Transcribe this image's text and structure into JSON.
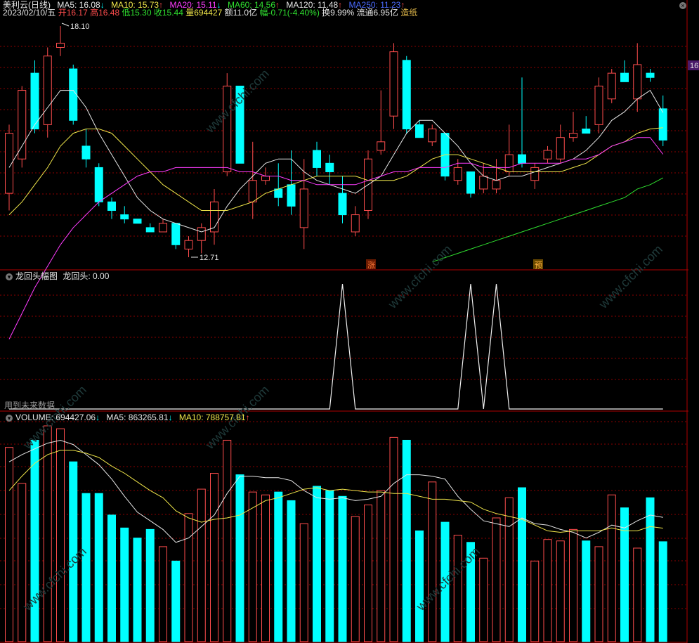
{
  "header": {
    "stock_name": "美利云(日线)",
    "ma5": "MA5: 16.08",
    "ma5_arrow": "↓",
    "ma10": "MA10: 15.73",
    "ma10_arrow": "↑",
    "ma20": "MA20: 15.11",
    "ma20_arrow": "↓",
    "ma60": "MA60: 14.56",
    "ma60_arrow": "↑",
    "ma120": "MA120: 11.48",
    "ma120_arrow": "↑",
    "ma250": "MA250: 11.23",
    "ma250_arrow": "↑",
    "date": "2023/02/10/五",
    "open": "开16.17",
    "high": "高16.48",
    "low": "低15.30",
    "close": "收15.44",
    "volume": "量694427",
    "amount": "额11.0亿",
    "change": "幅-0.71(-4.40%)",
    "turnover": "换9.99%",
    "float_cap": "流通6.95亿",
    "concept": "造纸",
    "price_tag": "16"
  },
  "indicator": {
    "title": "龙回头幅图",
    "value_label": "龙回头: 0.00",
    "note": "用到未来数据"
  },
  "volume_panel": {
    "vol_label": "VOLUME: 694427.06",
    "vol_arrow": "↓",
    "ma5_label": "MA5: 863265.81",
    "ma5_arrow": "↓",
    "ma10_label": "MA10: 788757.81",
    "ma10_arrow": "↑"
  },
  "annotations": {
    "high_label": "18.10",
    "low_label": "12.71",
    "zhang_mark": "涨",
    "yu_mark": "预"
  },
  "watermark": "www.cfchi.com",
  "colors": {
    "up": "#ff4d4d",
    "down": "#00ffff",
    "ma5": "#e6e6e6",
    "ma10": "#f0e64a",
    "ma20": "#ff3cff",
    "ma60": "#2fe02f",
    "grid": "#8b0000"
  },
  "chart_data": {
    "type": "candlestick",
    "candles": [
      {
        "o": 14.2,
        "h": 15.8,
        "l": 13.8,
        "c": 15.6
      },
      {
        "o": 15.0,
        "h": 16.7,
        "l": 14.8,
        "c": 16.6
      },
      {
        "o": 17.0,
        "h": 17.3,
        "l": 15.6,
        "c": 15.7
      },
      {
        "o": 15.8,
        "h": 17.6,
        "l": 15.5,
        "c": 17.4
      },
      {
        "o": 17.6,
        "h": 18.1,
        "l": 17.4,
        "c": 17.7
      },
      {
        "o": 17.1,
        "h": 17.2,
        "l": 15.8,
        "c": 15.9
      },
      {
        "o": 15.3,
        "h": 15.7,
        "l": 14.8,
        "c": 15.0
      },
      {
        "o": 14.8,
        "h": 14.9,
        "l": 13.9,
        "c": 14.0
      },
      {
        "o": 14.0,
        "h": 14.1,
        "l": 13.6,
        "c": 13.8
      },
      {
        "o": 13.7,
        "h": 13.9,
        "l": 13.5,
        "c": 13.6
      },
      {
        "o": 13.6,
        "h": 13.6,
        "l": 13.5,
        "c": 13.5
      },
      {
        "o": 13.4,
        "h": 13.5,
        "l": 13.3,
        "c": 13.3
      },
      {
        "o": 13.3,
        "h": 13.6,
        "l": 13.3,
        "c": 13.5
      },
      {
        "o": 13.5,
        "h": 13.5,
        "l": 12.9,
        "c": 13.0
      },
      {
        "o": 12.9,
        "h": 13.2,
        "l": 12.71,
        "c": 13.1
      },
      {
        "o": 13.1,
        "h": 13.5,
        "l": 12.8,
        "c": 13.4
      },
      {
        "o": 13.3,
        "h": 14.3,
        "l": 13.0,
        "c": 14.0
      },
      {
        "o": 14.7,
        "h": 17.0,
        "l": 14.6,
        "c": 16.7
      },
      {
        "o": 16.7,
        "h": 16.7,
        "l": 14.9,
        "c": 14.9
      },
      {
        "o": 14.0,
        "h": 15.4,
        "l": 13.6,
        "c": 14.5
      },
      {
        "o": 14.5,
        "h": 14.8,
        "l": 14.4,
        "c": 14.6
      },
      {
        "o": 14.3,
        "h": 14.9,
        "l": 13.9,
        "c": 14.1
      },
      {
        "o": 14.4,
        "h": 15.2,
        "l": 13.7,
        "c": 13.9
      },
      {
        "o": 13.4,
        "h": 15.0,
        "l": 12.9,
        "c": 14.3
      },
      {
        "o": 15.2,
        "h": 15.4,
        "l": 14.6,
        "c": 14.8
      },
      {
        "o": 14.9,
        "h": 15.1,
        "l": 14.4,
        "c": 14.7
      },
      {
        "o": 14.2,
        "h": 14.6,
        "l": 13.5,
        "c": 13.7
      },
      {
        "o": 13.3,
        "h": 13.9,
        "l": 13.2,
        "c": 13.7
      },
      {
        "o": 13.8,
        "h": 15.2,
        "l": 13.6,
        "c": 15.0
      },
      {
        "o": 15.2,
        "h": 16.6,
        "l": 15.1,
        "c": 15.4
      },
      {
        "o": 16.0,
        "h": 17.7,
        "l": 15.7,
        "c": 17.5
      },
      {
        "o": 17.3,
        "h": 17.4,
        "l": 15.6,
        "c": 15.7
      },
      {
        "o": 15.8,
        "h": 15.9,
        "l": 15.5,
        "c": 15.5
      },
      {
        "o": 15.4,
        "h": 15.8,
        "l": 15.3,
        "c": 15.7
      },
      {
        "o": 15.6,
        "h": 15.6,
        "l": 14.5,
        "c": 14.6
      },
      {
        "o": 14.5,
        "h": 15.0,
        "l": 14.4,
        "c": 14.8
      },
      {
        "o": 14.7,
        "h": 14.7,
        "l": 14.1,
        "c": 14.2
      },
      {
        "o": 14.3,
        "h": 14.9,
        "l": 14.2,
        "c": 14.6
      },
      {
        "o": 14.3,
        "h": 15.0,
        "l": 14.2,
        "c": 14.5
      },
      {
        "o": 14.7,
        "h": 15.8,
        "l": 14.6,
        "c": 15.1
      },
      {
        "o": 15.1,
        "h": 16.9,
        "l": 14.8,
        "c": 14.9
      },
      {
        "o": 14.5,
        "h": 14.9,
        "l": 14.3,
        "c": 14.8
      },
      {
        "o": 15.0,
        "h": 15.3,
        "l": 14.9,
        "c": 15.2
      },
      {
        "o": 15.0,
        "h": 15.8,
        "l": 14.9,
        "c": 15.5
      },
      {
        "o": 15.5,
        "h": 16.1,
        "l": 15.4,
        "c": 15.6
      },
      {
        "o": 15.7,
        "h": 16.0,
        "l": 15.6,
        "c": 15.6
      },
      {
        "o": 15.8,
        "h": 16.9,
        "l": 15.6,
        "c": 16.7
      },
      {
        "o": 16.4,
        "h": 17.1,
        "l": 16.3,
        "c": 17.0
      },
      {
        "o": 17.0,
        "h": 17.3,
        "l": 16.8,
        "c": 16.8
      },
      {
        "o": 16.4,
        "h": 17.7,
        "l": 16.1,
        "c": 17.2
      },
      {
        "o": 17.0,
        "h": 17.1,
        "l": 16.8,
        "c": 16.9
      },
      {
        "o": 16.17,
        "h": 16.48,
        "l": 15.3,
        "c": 15.44
      }
    ],
    "ma5": [
      14.8,
      15.3,
      15.8,
      16.2,
      16.6,
      16.6,
      16.2,
      15.6,
      15.1,
      14.6,
      14.1,
      13.8,
      13.6,
      13.5,
      13.4,
      13.3,
      13.4,
      13.9,
      14.3,
      14.6,
      14.9,
      15.0,
      15.0,
      14.7,
      14.5,
      14.4,
      14.3,
      14.2,
      14.4,
      14.6,
      15.1,
      15.6,
      15.9,
      15.9,
      15.6,
      15.3,
      14.9,
      14.6,
      14.5,
      14.6,
      14.6,
      14.7,
      14.8,
      14.9,
      15.0,
      15.2,
      15.5,
      15.9,
      16.1,
      16.4,
      16.6,
      16.08
    ],
    "ma10": [
      13.7,
      14.0,
      14.4,
      14.8,
      15.3,
      15.6,
      15.7,
      15.7,
      15.6,
      15.3,
      15.0,
      14.7,
      14.4,
      14.2,
      14.0,
      13.8,
      13.8,
      13.8,
      13.9,
      14.0,
      14.2,
      14.3,
      14.4,
      14.5,
      14.6,
      14.6,
      14.6,
      14.6,
      14.5,
      14.5,
      14.5,
      14.6,
      14.8,
      15.0,
      15.1,
      15.1,
      15.0,
      14.9,
      14.8,
      14.7,
      14.7,
      14.7,
      14.7,
      14.7,
      14.8,
      14.9,
      15.1,
      15.3,
      15.4,
      15.6,
      15.7,
      15.73
    ],
    "ma20": [
      10.8,
      11.4,
      12.0,
      12.5,
      13.0,
      13.4,
      13.7,
      14.0,
      14.2,
      14.4,
      14.6,
      14.7,
      14.7,
      14.8,
      14.8,
      14.8,
      14.8,
      14.8,
      14.7,
      14.7,
      14.6,
      14.6,
      14.5,
      14.5,
      14.4,
      14.4,
      14.4,
      14.4,
      14.5,
      14.6,
      14.7,
      14.7,
      14.8,
      14.8,
      14.8,
      14.9,
      14.9,
      14.8,
      14.8,
      14.8,
      14.9,
      14.9,
      14.9,
      14.9,
      15.0,
      15.0,
      15.1,
      15.3,
      15.4,
      15.5,
      15.5,
      15.11
    ],
    "ma60": [
      null,
      null,
      null,
      null,
      null,
      null,
      null,
      null,
      null,
      null,
      null,
      null,
      null,
      null,
      null,
      null,
      null,
      null,
      null,
      null,
      null,
      null,
      null,
      null,
      null,
      null,
      null,
      null,
      null,
      null,
      null,
      null,
      null,
      12.6,
      12.7,
      12.8,
      12.9,
      13.0,
      13.1,
      13.2,
      13.3,
      13.4,
      13.5,
      13.6,
      13.7,
      13.8,
      13.9,
      14.0,
      14.1,
      14.3,
      14.4,
      14.56
    ],
    "dragon": [
      0,
      0,
      0,
      0,
      0,
      0,
      0,
      0,
      0,
      0,
      0,
      0,
      0,
      0,
      0,
      0,
      0,
      0,
      0,
      0,
      0,
      0,
      0,
      0,
      0,
      0,
      1,
      0,
      0,
      0,
      0,
      0,
      0,
      0,
      0,
      0,
      1,
      0,
      1,
      0,
      0,
      0,
      0,
      0,
      0,
      0,
      0,
      0,
      0,
      0,
      0,
      0
    ],
    "volume": [
      1350000,
      1100000,
      1400000,
      1500000,
      1480000,
      1250000,
      1030000,
      1030000,
      880000,
      790000,
      720000,
      780000,
      660000,
      560000,
      890000,
      1060000,
      1170000,
      1400000,
      1160000,
      1040000,
      1020000,
      1040000,
      980000,
      820000,
      1080000,
      1050000,
      1010000,
      870000,
      950000,
      1050000,
      1420000,
      1400000,
      770000,
      1110000,
      830000,
      740000,
      690000,
      580000,
      860000,
      1000000,
      1070000,
      560000,
      710000,
      700000,
      780000,
      700000,
      660000,
      1020000,
      930000,
      650000,
      1000000,
      694427
    ],
    "vol_ma5": [
      1250000,
      1300000,
      1340000,
      1380000,
      1400000,
      1370000,
      1300000,
      1230000,
      1130000,
      1010000,
      900000,
      840000,
      780000,
      690000,
      720000,
      800000,
      880000,
      1030000,
      1150000,
      1150000,
      1140000,
      1140000,
      1120000,
      1050000,
      1000000,
      990000,
      1000000,
      980000,
      990000,
      1010000,
      1100000,
      1160000,
      1160000,
      1150000,
      1130000,
      1010000,
      920000,
      840000,
      820000,
      800000,
      860000,
      820000,
      810000,
      780000,
      760000,
      720000,
      760000,
      810000,
      790000,
      840000,
      880000,
      863265
    ],
    "vol_ma10": [
      1050000,
      1150000,
      1240000,
      1300000,
      1330000,
      1330000,
      1310000,
      1280000,
      1220000,
      1170000,
      1110000,
      1050000,
      1000000,
      910000,
      860000,
      830000,
      850000,
      860000,
      880000,
      930000,
      980000,
      1000000,
      1030000,
      1060000,
      1070000,
      1050000,
      1060000,
      1050000,
      1040000,
      1040000,
      1030000,
      1030000,
      1010000,
      990000,
      990000,
      980000,
      970000,
      920000,
      890000,
      870000,
      850000,
      810000,
      770000,
      760000,
      770000,
      770000,
      770000,
      790000,
      770000,
      770000,
      800000,
      788757
    ]
  }
}
